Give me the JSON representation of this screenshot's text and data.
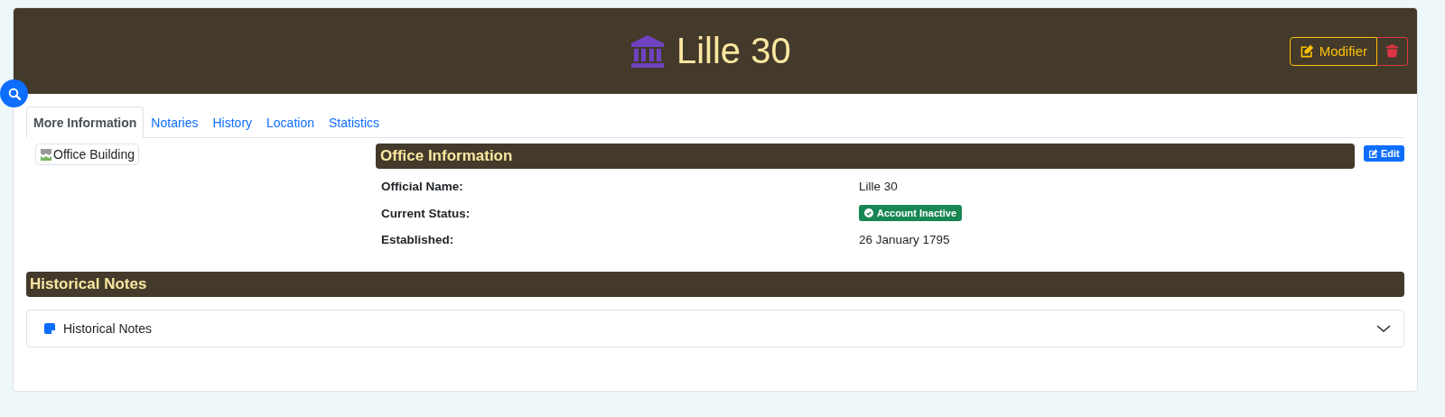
{
  "header": {
    "title": "Lille 30",
    "buttons": [
      {
        "kind": "edit",
        "label": "Modifier"
      },
      {
        "kind": "delete"
      }
    ]
  },
  "tabs": [
    {
      "label": "More Information",
      "selected": true
    },
    {
      "label": "Notaries",
      "selected": false
    },
    {
      "label": "History",
      "selected": false
    },
    {
      "label": "Location",
      "selected": false
    },
    {
      "label": "Statistics",
      "selected": false
    }
  ],
  "image": {
    "alt": "Office Building"
  },
  "office_info": {
    "title": "Office Information",
    "edit_label": "Edit",
    "rows": [
      {
        "label": "Official Name:",
        "kind": "text",
        "value": "Lille 30"
      },
      {
        "label": "Current Status:",
        "kind": "badge",
        "value": "Account Inactive"
      },
      {
        "label": "Established:",
        "kind": "text",
        "value": "26 January 1795"
      }
    ]
  },
  "historical_notes": {
    "title": "Historical Notes",
    "accordion": {
      "label": "Historical Notes",
      "expanded": false
    }
  }
}
